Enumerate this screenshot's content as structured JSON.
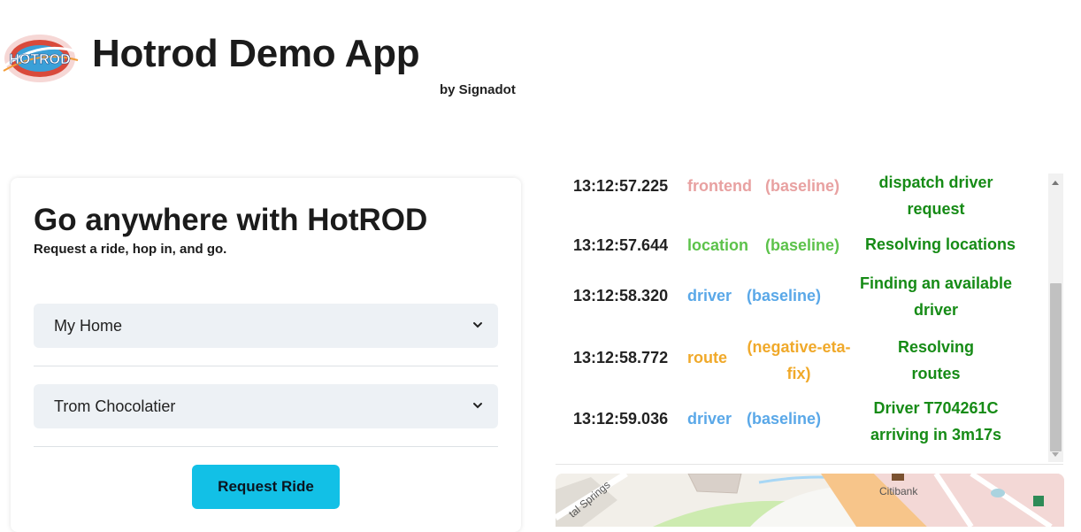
{
  "header": {
    "logo_text": "HOTROD",
    "title": "Hotrod Demo App",
    "byline": "by Signadot"
  },
  "booking": {
    "heading": "Go anywhere with HotROD",
    "subheading": "Request a ride, hop in, and go.",
    "pickup": {
      "value": "My Home",
      "icon": "chevron-down-icon"
    },
    "dropoff": {
      "value": "Trom Chocolatier",
      "icon": "chevron-down-icon"
    },
    "request_button": "Request Ride"
  },
  "log": {
    "entries": [
      {
        "time": "13:12:57.225",
        "service": "frontend",
        "tag": "(baseline)",
        "message_lines": [
          "dispatch driver",
          "request"
        ],
        "service_color": "#e8a1a1",
        "tag_color": "#e8a1a1"
      },
      {
        "time": "13:12:57.644",
        "service": "location",
        "tag": "(baseline)",
        "message_lines": [
          "Resolving locations"
        ],
        "service_color": "#5cc24a",
        "tag_color": "#5cc24a"
      },
      {
        "time": "13:12:58.320",
        "service": "driver",
        "tag": "(baseline)",
        "message_lines": [
          "Finding an available",
          "driver"
        ],
        "service_color": "#5aa8e8",
        "tag_color": "#5aa8e8"
      },
      {
        "time": "13:12:58.772",
        "service": "route",
        "tag_lines": [
          "(negative-eta-",
          "fix)"
        ],
        "message_lines": [
          "Resolving",
          "routes"
        ],
        "service_color": "#f0a92a",
        "tag_color": "#f0a92a"
      },
      {
        "time": "13:12:59.036",
        "service": "driver",
        "tag": "(baseline)",
        "message_lines": [
          "Driver T704261C",
          "arriving in 3m17s"
        ],
        "service_color": "#5aa8e8",
        "tag_color": "#5aa8e8"
      }
    ],
    "message_color": "#168b16"
  },
  "map": {
    "labels": [
      "tal Springs",
      "Citibank"
    ]
  }
}
